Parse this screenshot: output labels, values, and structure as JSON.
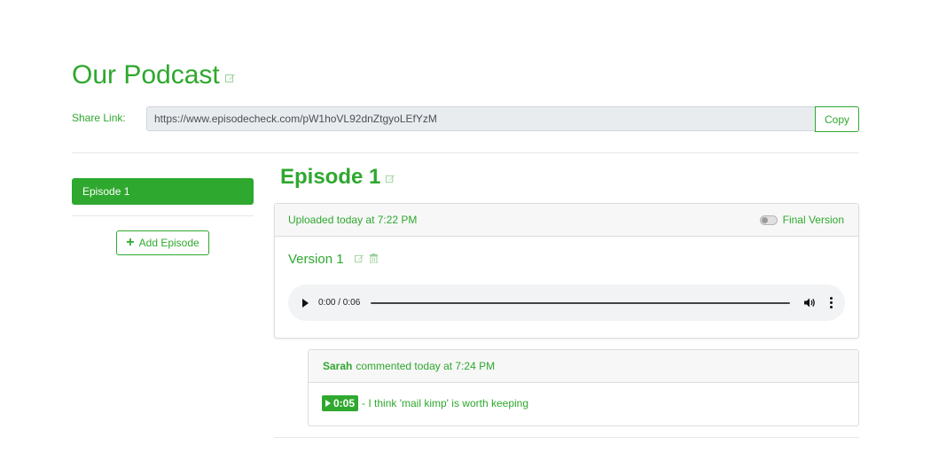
{
  "podcast": {
    "title": "Our Podcast",
    "share_label": "Share Link:",
    "share_url": "https://www.episodecheck.com/pW1hoVL92dnZtgyoLEfYzM",
    "copy_label": "Copy"
  },
  "sidebar": {
    "items": [
      {
        "label": "Episode 1",
        "active": true
      }
    ],
    "add_episode_label": "Add Episode"
  },
  "episode": {
    "title": "Episode 1",
    "uploaded_text": "Uploaded today at 7:22 PM",
    "final_version_label": "Final Version",
    "final_version_on": false,
    "version_title": "Version 1",
    "player": {
      "time": "0:00 / 0:06",
      "progress": 0
    }
  },
  "comment": {
    "author": "Sarah",
    "meta": "commented today at 7:24 PM",
    "timestamp": "0:05",
    "text": "- I think 'mail kimp' is worth keeping"
  },
  "colors": {
    "accent": "#2ea82e",
    "muted_bg": "#f7f7f7",
    "border": "#dcdcdc"
  },
  "icons": [
    "edit-icon",
    "trash-icon",
    "play-icon",
    "volume-icon",
    "more-icon",
    "plus-icon"
  ]
}
